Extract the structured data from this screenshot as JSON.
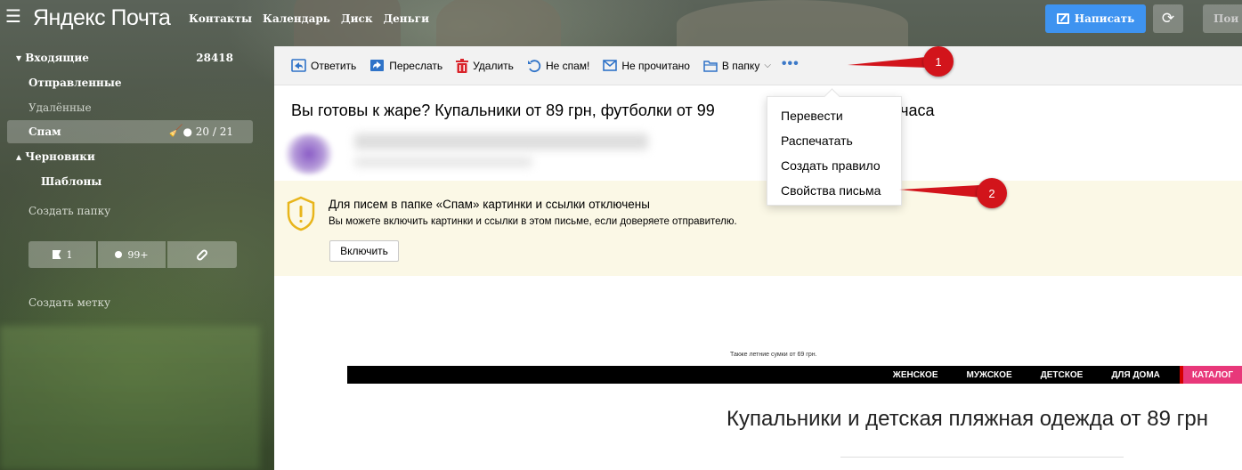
{
  "header": {
    "logo_yandex": "Яндекс",
    "logo_mail": "Почта",
    "nav": [
      "Контакты",
      "Календарь",
      "Диск",
      "Деньги"
    ],
    "compose_label": "Написать",
    "search_label": "Пои"
  },
  "sidebar": {
    "folders": [
      {
        "label": "▾ Входящие",
        "count": "28418"
      },
      {
        "label": "Отправленные",
        "count": ""
      },
      {
        "label": "Удалённые",
        "count": ""
      },
      {
        "label": "Спам",
        "count": "● 20 / 21"
      },
      {
        "label": "▴ Черновики",
        "count": ""
      },
      {
        "label": "Шаблоны",
        "count": ""
      }
    ],
    "create_folder": "Создать папку",
    "filters": [
      {
        "icon": "flag-icon",
        "label": "1"
      },
      {
        "icon": "dot-icon",
        "label": "99+"
      },
      {
        "icon": "paperclip-icon",
        "label": ""
      }
    ],
    "create_label": "Создать метку"
  },
  "toolbar": {
    "reply": "Ответить",
    "forward": "Переслать",
    "delete": "Удалить",
    "not_spam": "Не спам!",
    "unread": "Не прочитано",
    "to_folder": "В папку",
    "more": "•••"
  },
  "message": {
    "subject_start": "Вы готовы к жаре? Купальники от 89 грн, футболки от 99",
    "subject_end": "за 24 часа"
  },
  "notice": {
    "title": "Для писем в папке «Спам» картинки и ссылки отключены",
    "text": "Вы можете включить картинки и ссылки в этом письме, если доверяете отправителю.",
    "button": "Включить"
  },
  "email_body": {
    "preheader": "Также летние сумки от 69 грн.",
    "nav": [
      "ЖЕНСКОЕ",
      "МУЖСКОЕ",
      "ДЕТСКОЕ",
      "ДЛЯ ДОМА"
    ],
    "catalog": "КАТАЛОГ",
    "headline": "Купальники и детская пляжная одежда от 89 грн"
  },
  "more_menu": {
    "items": [
      "Перевести",
      "Распечатать",
      "Создать правило",
      "Свойства письма"
    ]
  },
  "annotations": [
    "1",
    "2"
  ],
  "colors": {
    "compose": "#3e93f0",
    "toolbar_icon": "#2f73c8",
    "delete_icon": "#d9232a",
    "notice_bg": "#fbf8e6",
    "shield": "#e8b51b",
    "callout": "#d2141b",
    "catalog": "#e8387a"
  }
}
